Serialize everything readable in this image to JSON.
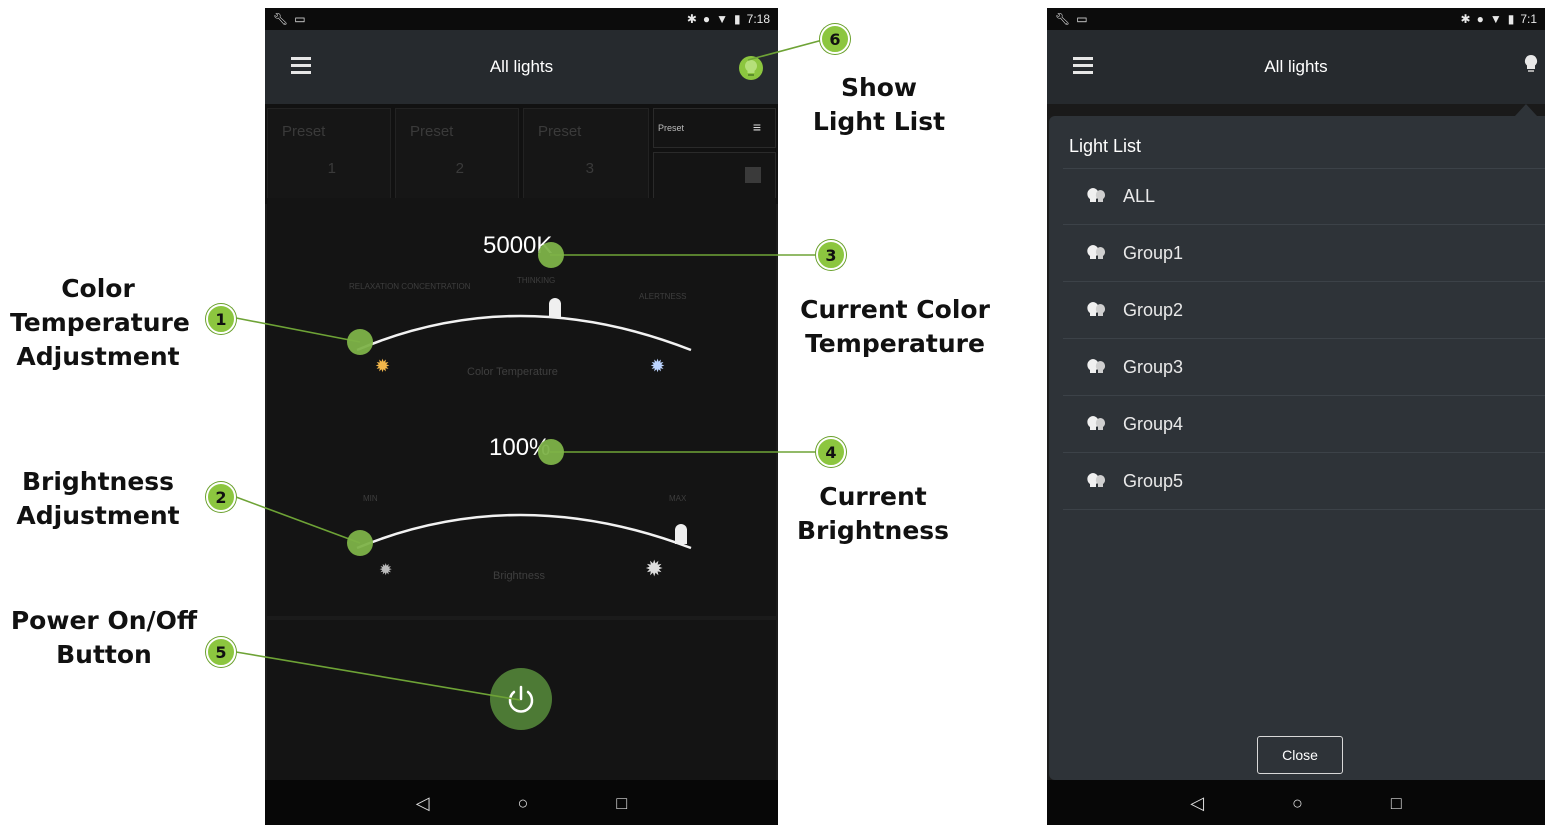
{
  "left_phone": {
    "status_time": "7:18",
    "title": "All lights",
    "presets": [
      {
        "label": "Preset",
        "number": "1"
      },
      {
        "label": "Preset",
        "number": "2"
      },
      {
        "label": "Preset",
        "number": "3"
      }
    ],
    "preset_button_label": "Preset",
    "color_temperature_value": "5000K",
    "color_temperature_caption": "Color Temperature",
    "brightness_value": "100%",
    "brightness_caption": "Brightness",
    "brightness_min": "MIN",
    "brightness_max": "MAX",
    "color_temperature_fraction": 0.5,
    "brightness_fraction": 1.0
  },
  "right_phone": {
    "status_time": "7:1",
    "title": "All lights",
    "drawer_title": "Light List",
    "items": [
      "ALL",
      "Group1",
      "Group2",
      "Group3",
      "Group4",
      "Group5"
    ],
    "close_label": "Close"
  },
  "annotations": {
    "a1": {
      "number": "1",
      "line1": "Color",
      "line2": "Temperature",
      "line3": "Adjustment"
    },
    "a2": {
      "number": "2",
      "line1": "Brightness",
      "line2": "Adjustment"
    },
    "a3": {
      "number": "3",
      "line1": "Current Color",
      "line2": "Temperature"
    },
    "a4": {
      "number": "4",
      "line1": "Current",
      "line2": "Brightness"
    },
    "a5": {
      "number": "5",
      "line1": "Power On/Off",
      "line2": "Button"
    },
    "a6": {
      "number": "6",
      "line1": "Show",
      "line2": "Light List"
    }
  },
  "colors": {
    "accent_green": "#8cc63f",
    "power_green": "#4d7a35",
    "drawer_bg": "#2e3338"
  }
}
